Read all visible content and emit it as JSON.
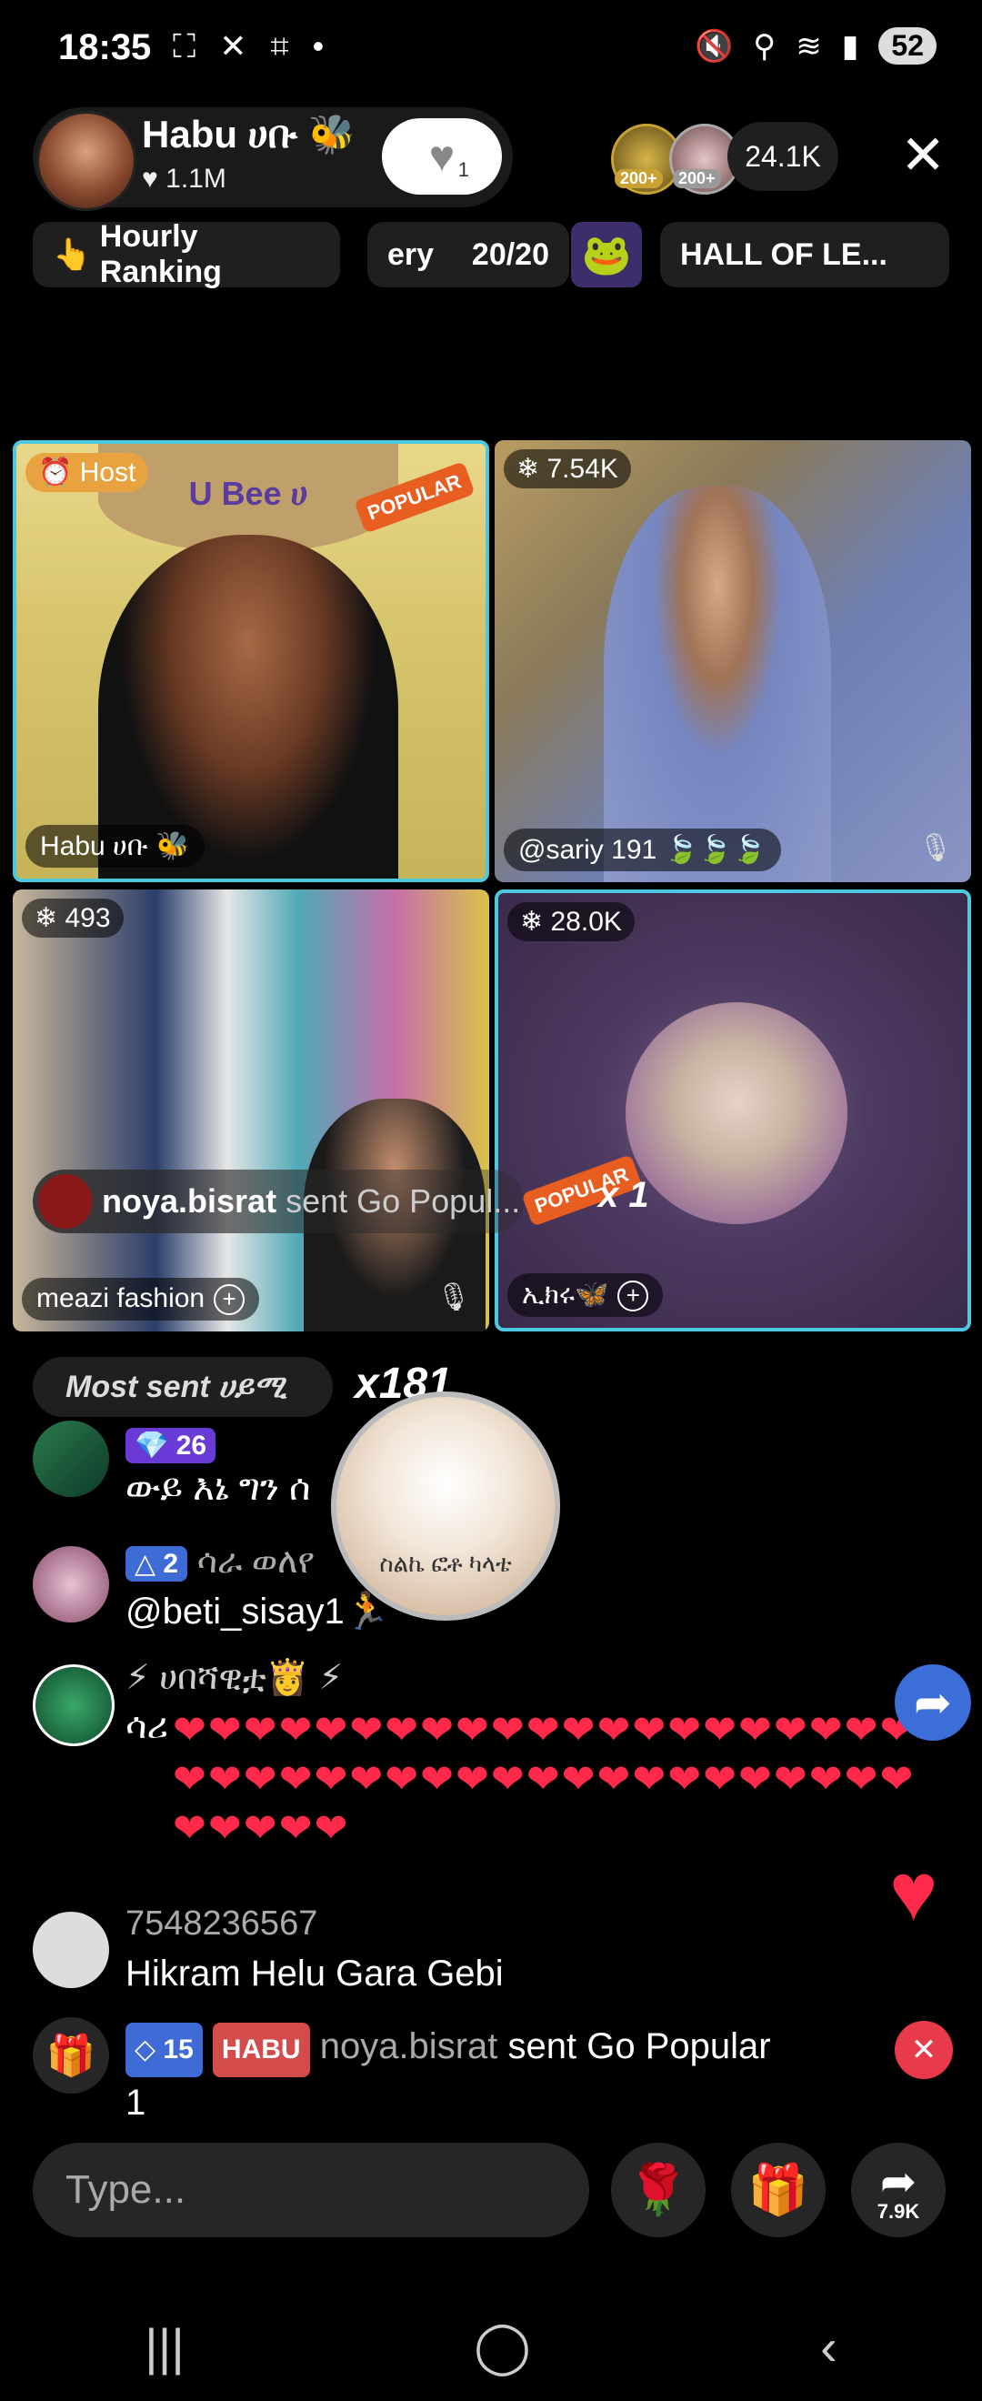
{
  "status_bar": {
    "time": "18:35",
    "battery": "52"
  },
  "host": {
    "name": "Habu ሀቡ 🐝",
    "likes": "1.1M",
    "follow_count": "1"
  },
  "viewers": {
    "badge1": "200+",
    "badge2": "200+",
    "count": "24.1K"
  },
  "ranking": {
    "hourly": "Hourly Ranking",
    "lottery": "ery",
    "progress": "20/20",
    "hall": "HALL OF LE..."
  },
  "tiles": [
    {
      "badge": "Host",
      "label": "Habu ሀቡ 🐝",
      "banner": "U Bee ሀ"
    },
    {
      "count": "7.54K",
      "label": "@sariy 191 🍃🍃🍃"
    },
    {
      "count": "493",
      "label": "meazi fashion"
    },
    {
      "count": "28.0K",
      "label": "ኢክሩ🦋"
    }
  ],
  "gift_banner": {
    "sender": "noya.bisrat",
    "action": "sent Go Popul...",
    "multiplier": "x 1"
  },
  "most_sent": {
    "label": "Most sent ሀይሚ",
    "count": "x181"
  },
  "overlay_avatar_text": "ስልኬ ፎቶ ካላቴ",
  "chat": [
    {
      "level": "26",
      "text": "ውይ እኔ ግን ሰ"
    },
    {
      "level": "2",
      "name": "ሳራ ወለየ",
      "text": "@beti_sisay1🏃"
    },
    {
      "name": "⚡ ሀበሻዊቷ👸 ⚡",
      "text": "ሳሪ"
    },
    {
      "name": "7548236567",
      "text": "Hikram Helu Gara Gebi"
    },
    {
      "level": "15",
      "tag": "HABU",
      "name": "noya.bisrat",
      "text": "sent Go Popular",
      "extra": "1"
    }
  ],
  "hearts_count": 47,
  "input": {
    "placeholder": "Type..."
  },
  "share_count": "7.9K"
}
